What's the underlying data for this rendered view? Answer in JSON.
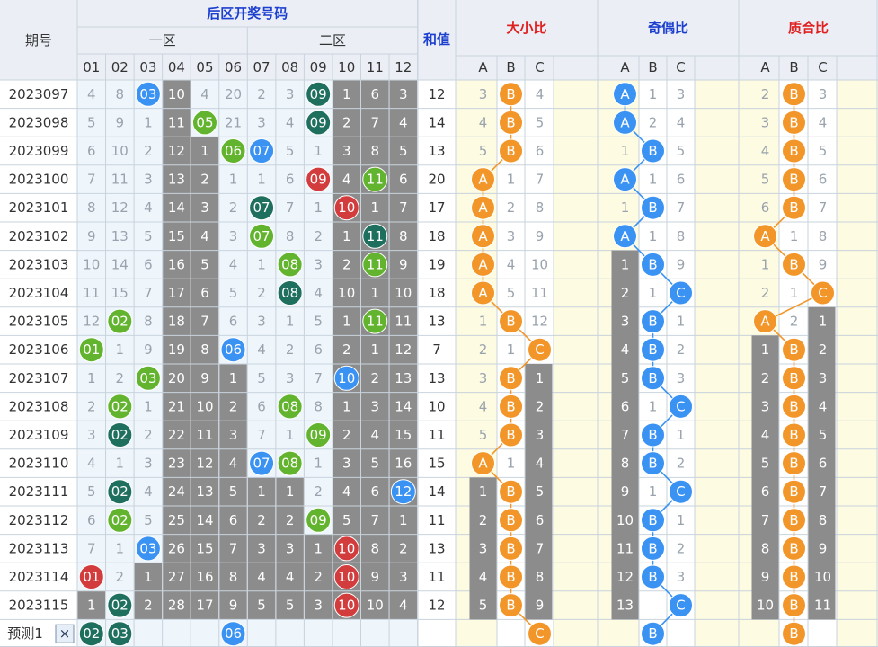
{
  "header": {
    "period_label": "期号",
    "back_zone_title": "后区开奖号码",
    "zone1_label": "一区",
    "zone2_label": "二区",
    "sum_label": "和值",
    "size_title": "大小比",
    "parity_title": "奇偶比",
    "prime_title": "质合比",
    "number_labels": [
      "01",
      "02",
      "03",
      "04",
      "05",
      "06",
      "07",
      "08",
      "09",
      "10",
      "11",
      "12"
    ],
    "abc_labels": [
      "A",
      "B",
      "C"
    ]
  },
  "rows": [
    {
      "period": "2023097",
      "cells": [
        "4",
        "8",
        "03",
        "10",
        "4",
        "20",
        "2",
        "3",
        "09",
        "1",
        "6",
        "3"
      ],
      "sum": "12",
      "size": [
        "3",
        "B",
        "4"
      ],
      "parity": [
        "A",
        "1",
        "3"
      ],
      "prime": [
        "2",
        "B",
        "3"
      ]
    },
    {
      "period": "2023098",
      "cells": [
        "5",
        "9",
        "1",
        "11",
        "05",
        "21",
        "3",
        "4",
        "09",
        "2",
        "7",
        "4"
      ],
      "sum": "14",
      "size": [
        "4",
        "B",
        "5"
      ],
      "parity": [
        "A",
        "2",
        "4"
      ],
      "prime": [
        "3",
        "B",
        "4"
      ]
    },
    {
      "period": "2023099",
      "cells": [
        "6",
        "10",
        "2",
        "12",
        "1",
        "06",
        "07",
        "5",
        "1",
        "3",
        "8",
        "5"
      ],
      "sum": "13",
      "size": [
        "5",
        "B",
        "6"
      ],
      "parity": [
        "1",
        "B",
        "5"
      ],
      "prime": [
        "4",
        "B",
        "5"
      ]
    },
    {
      "period": "2023100",
      "cells": [
        "7",
        "11",
        "3",
        "13",
        "2",
        "1",
        "1",
        "6",
        "09",
        "4",
        "11",
        "6"
      ],
      "sum": "20",
      "size": [
        "A",
        "1",
        "7"
      ],
      "parity": [
        "A",
        "1",
        "6"
      ],
      "prime": [
        "5",
        "B",
        "6"
      ]
    },
    {
      "period": "2023101",
      "cells": [
        "8",
        "12",
        "4",
        "14",
        "3",
        "2",
        "07",
        "7",
        "1",
        "10",
        "1",
        "7"
      ],
      "sum": "17",
      "size": [
        "A",
        "2",
        "8"
      ],
      "parity": [
        "1",
        "B",
        "7"
      ],
      "prime": [
        "6",
        "B",
        "7"
      ]
    },
    {
      "period": "2023102",
      "cells": [
        "9",
        "13",
        "5",
        "15",
        "4",
        "3",
        "07",
        "8",
        "2",
        "1",
        "11",
        "8"
      ],
      "sum": "18",
      "size": [
        "A",
        "3",
        "9"
      ],
      "parity": [
        "A",
        "1",
        "8"
      ],
      "prime": [
        "A",
        "1",
        "8"
      ]
    },
    {
      "period": "2023103",
      "cells": [
        "10",
        "14",
        "6",
        "16",
        "5",
        "4",
        "1",
        "08",
        "3",
        "2",
        "11",
        "9"
      ],
      "sum": "19",
      "size": [
        "A",
        "4",
        "10"
      ],
      "parity": [
        "1",
        "B",
        "9"
      ],
      "prime": [
        "1",
        "B",
        "9"
      ]
    },
    {
      "period": "2023104",
      "cells": [
        "11",
        "15",
        "7",
        "17",
        "6",
        "5",
        "2",
        "08",
        "4",
        "10",
        "1",
        "10"
      ],
      "sum": "18",
      "size": [
        "A",
        "5",
        "11"
      ],
      "parity": [
        "2",
        "1",
        "C"
      ],
      "prime": [
        "2",
        "1",
        "C"
      ]
    },
    {
      "period": "2023105",
      "cells": [
        "12",
        "02",
        "8",
        "18",
        "7",
        "6",
        "3",
        "1",
        "5",
        "1",
        "11",
        "11"
      ],
      "sum": "13",
      "size": [
        "1",
        "B",
        "12"
      ],
      "parity": [
        "3",
        "B",
        "1"
      ],
      "prime": [
        "A",
        "2",
        "1"
      ]
    },
    {
      "period": "2023106",
      "cells": [
        "01",
        "1",
        "9",
        "19",
        "8",
        "06",
        "4",
        "2",
        "6",
        "2",
        "1",
        "12"
      ],
      "sum": "7",
      "size": [
        "2",
        "1",
        "C"
      ],
      "parity": [
        "4",
        "B",
        "2"
      ],
      "prime": [
        "1",
        "B",
        "2"
      ]
    },
    {
      "period": "2023107",
      "cells": [
        "1",
        "2",
        "03",
        "20",
        "9",
        "1",
        "5",
        "3",
        "7",
        "10",
        "2",
        "13"
      ],
      "sum": "13",
      "size": [
        "3",
        "B",
        "1"
      ],
      "parity": [
        "5",
        "B",
        "3"
      ],
      "prime": [
        "2",
        "B",
        "3"
      ]
    },
    {
      "period": "2023108",
      "cells": [
        "2",
        "02",
        "1",
        "21",
        "10",
        "2",
        "6",
        "08",
        "8",
        "1",
        "3",
        "14"
      ],
      "sum": "10",
      "size": [
        "4",
        "B",
        "2"
      ],
      "parity": [
        "6",
        "1",
        "C"
      ],
      "prime": [
        "3",
        "B",
        "4"
      ]
    },
    {
      "period": "2023109",
      "cells": [
        "3",
        "02",
        "2",
        "22",
        "11",
        "3",
        "7",
        "1",
        "09",
        "2",
        "4",
        "15"
      ],
      "sum": "11",
      "size": [
        "5",
        "B",
        "3"
      ],
      "parity": [
        "7",
        "B",
        "1"
      ],
      "prime": [
        "4",
        "B",
        "5"
      ]
    },
    {
      "period": "2023110",
      "cells": [
        "4",
        "1",
        "3",
        "23",
        "12",
        "4",
        "07",
        "08",
        "1",
        "3",
        "5",
        "16"
      ],
      "sum": "15",
      "size": [
        "A",
        "1",
        "4"
      ],
      "parity": [
        "8",
        "B",
        "2"
      ],
      "prime": [
        "5",
        "B",
        "6"
      ]
    },
    {
      "period": "2023111",
      "cells": [
        "5",
        "02",
        "4",
        "24",
        "13",
        "5",
        "1",
        "1",
        "2",
        "4",
        "6",
        "12"
      ],
      "sum": "14",
      "size": [
        "1",
        "B",
        "5"
      ],
      "parity": [
        "9",
        "1",
        "C"
      ],
      "prime": [
        "6",
        "B",
        "7"
      ]
    },
    {
      "period": "2023112",
      "cells": [
        "6",
        "02",
        "5",
        "25",
        "14",
        "6",
        "2",
        "2",
        "09",
        "5",
        "7",
        "1"
      ],
      "sum": "11",
      "size": [
        "2",
        "B",
        "6"
      ],
      "parity": [
        "10",
        "B",
        "1"
      ],
      "prime": [
        "7",
        "B",
        "8"
      ]
    },
    {
      "period": "2023113",
      "cells": [
        "7",
        "1",
        "03",
        "26",
        "15",
        "7",
        "3",
        "3",
        "1",
        "10",
        "8",
        "2"
      ],
      "sum": "13",
      "size": [
        "3",
        "B",
        "7"
      ],
      "parity": [
        "11",
        "B",
        "2"
      ],
      "prime": [
        "8",
        "B",
        "9"
      ]
    },
    {
      "period": "2023114",
      "cells": [
        "01",
        "2",
        "1",
        "27",
        "16",
        "8",
        "4",
        "4",
        "2",
        "10",
        "9",
        "3"
      ],
      "sum": "11",
      "size": [
        "4",
        "B",
        "8"
      ],
      "parity": [
        "12",
        "B",
        "3"
      ],
      "prime": [
        "9",
        "B",
        "10"
      ]
    },
    {
      "period": "2023115",
      "cells": [
        "1",
        "02",
        "2",
        "28",
        "17",
        "9",
        "5",
        "5",
        "3",
        "10",
        "10",
        "4"
      ],
      "sum": "12",
      "size": [
        "5",
        "B",
        "9"
      ],
      "parity": [
        "13",
        "1",
        "C"
      ],
      "prime": [
        "10",
        "B",
        "11"
      ]
    }
  ],
  "predict": {
    "label": "预测1",
    "close_label": "×",
    "balls": [
      "02",
      "03",
      "",
      "",
      "",
      "06",
      "",
      "",
      "",
      "",
      "",
      ""
    ],
    "size": "C",
    "parity": "B",
    "prime": "B"
  },
  "colors": {
    "header_bg": "#ebeff5",
    "title_blue": "#1c3fcf",
    "title_red": "#e02020",
    "missing_text": "#9aa3ad",
    "gray_block": "#8c8c8c",
    "ball_blue": "#3a92f2",
    "ball_red": "#d23c3c",
    "ball_green": "#62b32e",
    "ball_teal": "#1f6f5f",
    "ball_orange": "#f2962a",
    "stripe_light": "#eef5fb",
    "stripe_yellow": "#fdfbe1"
  }
}
